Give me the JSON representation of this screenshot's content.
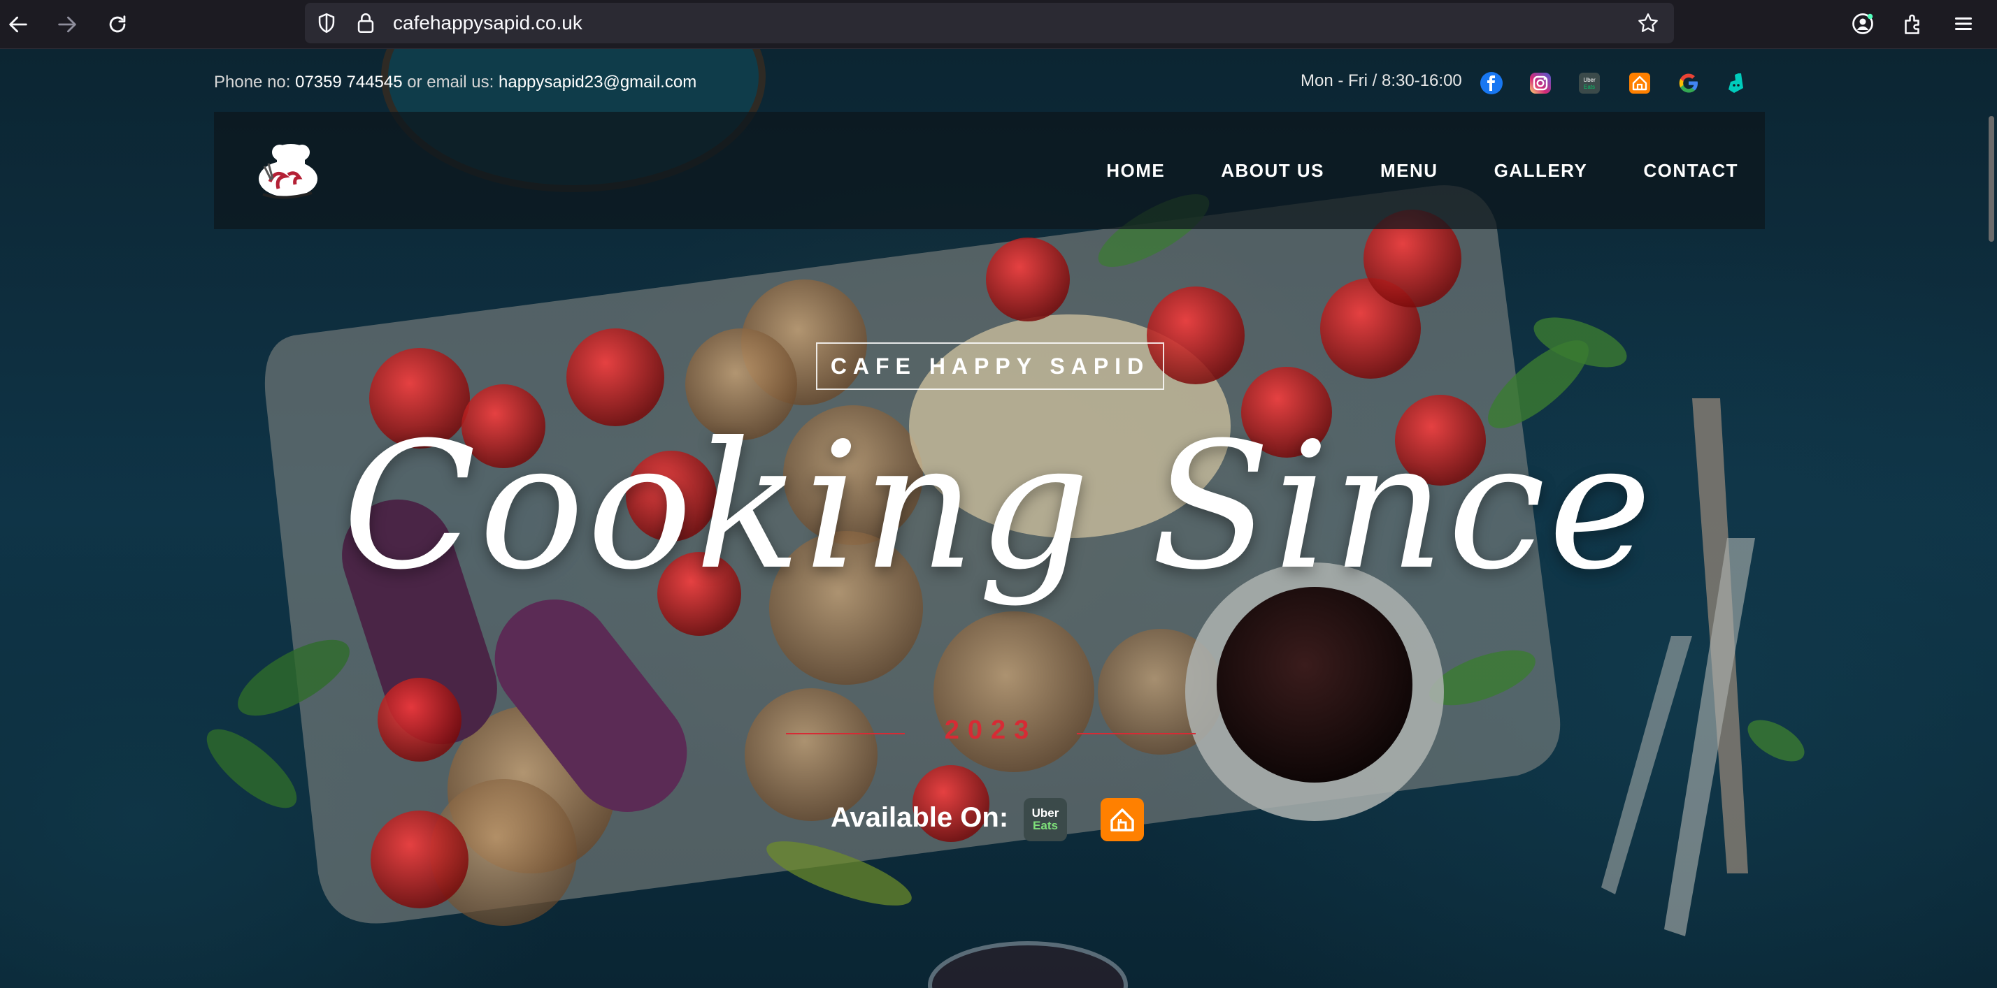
{
  "browser": {
    "url": "cafehappysapid.co.uk"
  },
  "topbar": {
    "phone_label": "Phone no:",
    "phone": "07359 744545",
    "or_email_label": "or email us:",
    "email": "happysapid23@gmail.com",
    "hours": "Mon - Fri / 8:30-16:00",
    "social_icons": [
      "facebook-icon",
      "instagram-icon",
      "uber-eats-icon",
      "just-eat-icon",
      "google-icon",
      "deliveroo-icon"
    ]
  },
  "nav": {
    "logo_alt": "Cafe Happy Sapid",
    "items": [
      {
        "label": "HOME"
      },
      {
        "label": "ABOUT US"
      },
      {
        "label": "MENU"
      },
      {
        "label": "GALLERY"
      },
      {
        "label": "CONTACT"
      }
    ]
  },
  "hero": {
    "tagline": "CAFE HAPPY SAPID",
    "title": "Cooking Since",
    "year": "2023",
    "available_label": "Available On:",
    "apps": [
      "uber-eats-icon",
      "just-eat-icon"
    ]
  },
  "uber_eats_badge": {
    "line1": "Uber",
    "line2": "Eats"
  },
  "colors": {
    "accent_red": "#d62b35",
    "just_eat_orange": "#ff8000",
    "chrome_bg": "#1c1b22"
  }
}
